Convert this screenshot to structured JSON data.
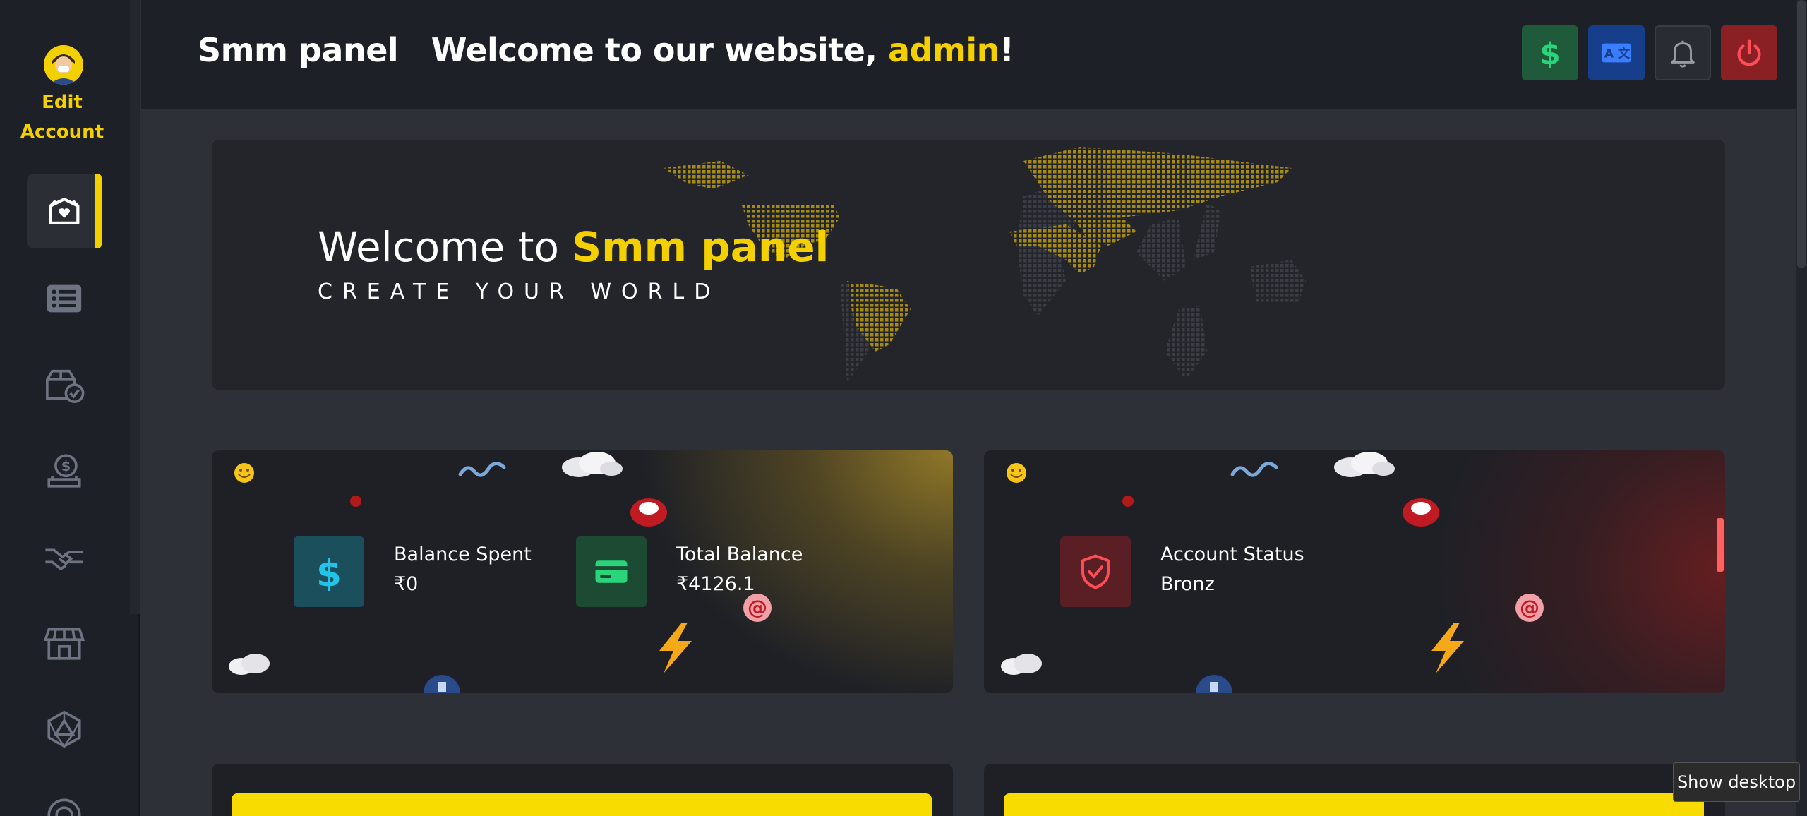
{
  "sidebar": {
    "edit_account_label": "Edit Account",
    "items": [
      {
        "name": "new-order",
        "icon": "box-heart-icon",
        "active": true
      },
      {
        "name": "services",
        "icon": "list-icon"
      },
      {
        "name": "orders",
        "icon": "box-check-icon"
      },
      {
        "name": "add-funds",
        "icon": "money-hand-icon"
      },
      {
        "name": "affiliates",
        "icon": "handshake-icon"
      },
      {
        "name": "store",
        "icon": "store-icon"
      },
      {
        "name": "api",
        "icon": "polyhedron-icon"
      },
      {
        "name": "more",
        "icon": "target-icon"
      }
    ]
  },
  "header": {
    "brand": "Smm panel",
    "welcome_prefix": "Welcome to our website,",
    "username": "admin",
    "welcome_suffix": "!",
    "buttons": [
      {
        "name": "balance-button",
        "icon": "dollar-icon",
        "color": "#1f5b3a",
        "icon_color": "#2ad47a"
      },
      {
        "name": "language-button",
        "icon": "translate-icon",
        "color": "#163e8a",
        "icon_color": "#3a7dff"
      },
      {
        "name": "notifications-button",
        "icon": "bell-icon",
        "color": "#2a2c34",
        "icon_color": "#9a9ca4"
      },
      {
        "name": "logout-button",
        "icon": "power-icon",
        "color": "#8a1f24",
        "icon_color": "#ff4d55"
      }
    ]
  },
  "banner": {
    "title_prefix": "Welcome to",
    "title_brand": "Smm panel",
    "subtitle": "CREATE YOUR WORLD"
  },
  "stats": {
    "balance_spent": {
      "label": "Balance Spent",
      "value": "₹0",
      "icon": "dollar-icon",
      "color": "#1b4f5c",
      "icon_color": "#21c4e8"
    },
    "total_balance": {
      "label": "Total Balance",
      "value": "₹4126.1",
      "icon": "credit-card-icon",
      "color": "#1c4a33",
      "icon_color": "#2ad47a"
    },
    "account_status": {
      "label": "Account Status",
      "value": "Bronz",
      "icon": "shield-check-icon",
      "color": "#5a1f24",
      "icon_color": "#ff4d55"
    }
  },
  "tooltip": "Show desktop",
  "colors": {
    "accent": "#f5d000",
    "background": "#2e3038",
    "panel": "#1e2028"
  }
}
